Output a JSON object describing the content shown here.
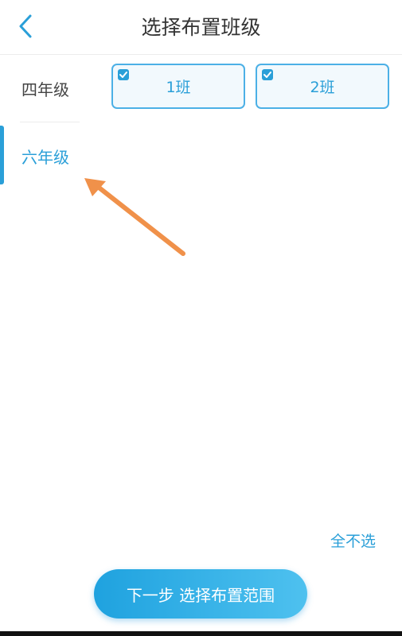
{
  "header": {
    "title": "选择布置班级",
    "back_icon": "chevron-left-icon"
  },
  "sidebar": {
    "items": [
      {
        "label": "四年级",
        "active": false
      },
      {
        "label": "六年级",
        "active": true
      }
    ]
  },
  "classes": [
    {
      "label": "1班",
      "checked": true
    },
    {
      "label": "2班",
      "checked": true
    }
  ],
  "actions": {
    "deselect_all_label": "全不选",
    "next_button_label": "下一步 选择布置范围"
  },
  "colors": {
    "accent": "#2a9fd8",
    "annotation_arrow": "#f0914a"
  }
}
